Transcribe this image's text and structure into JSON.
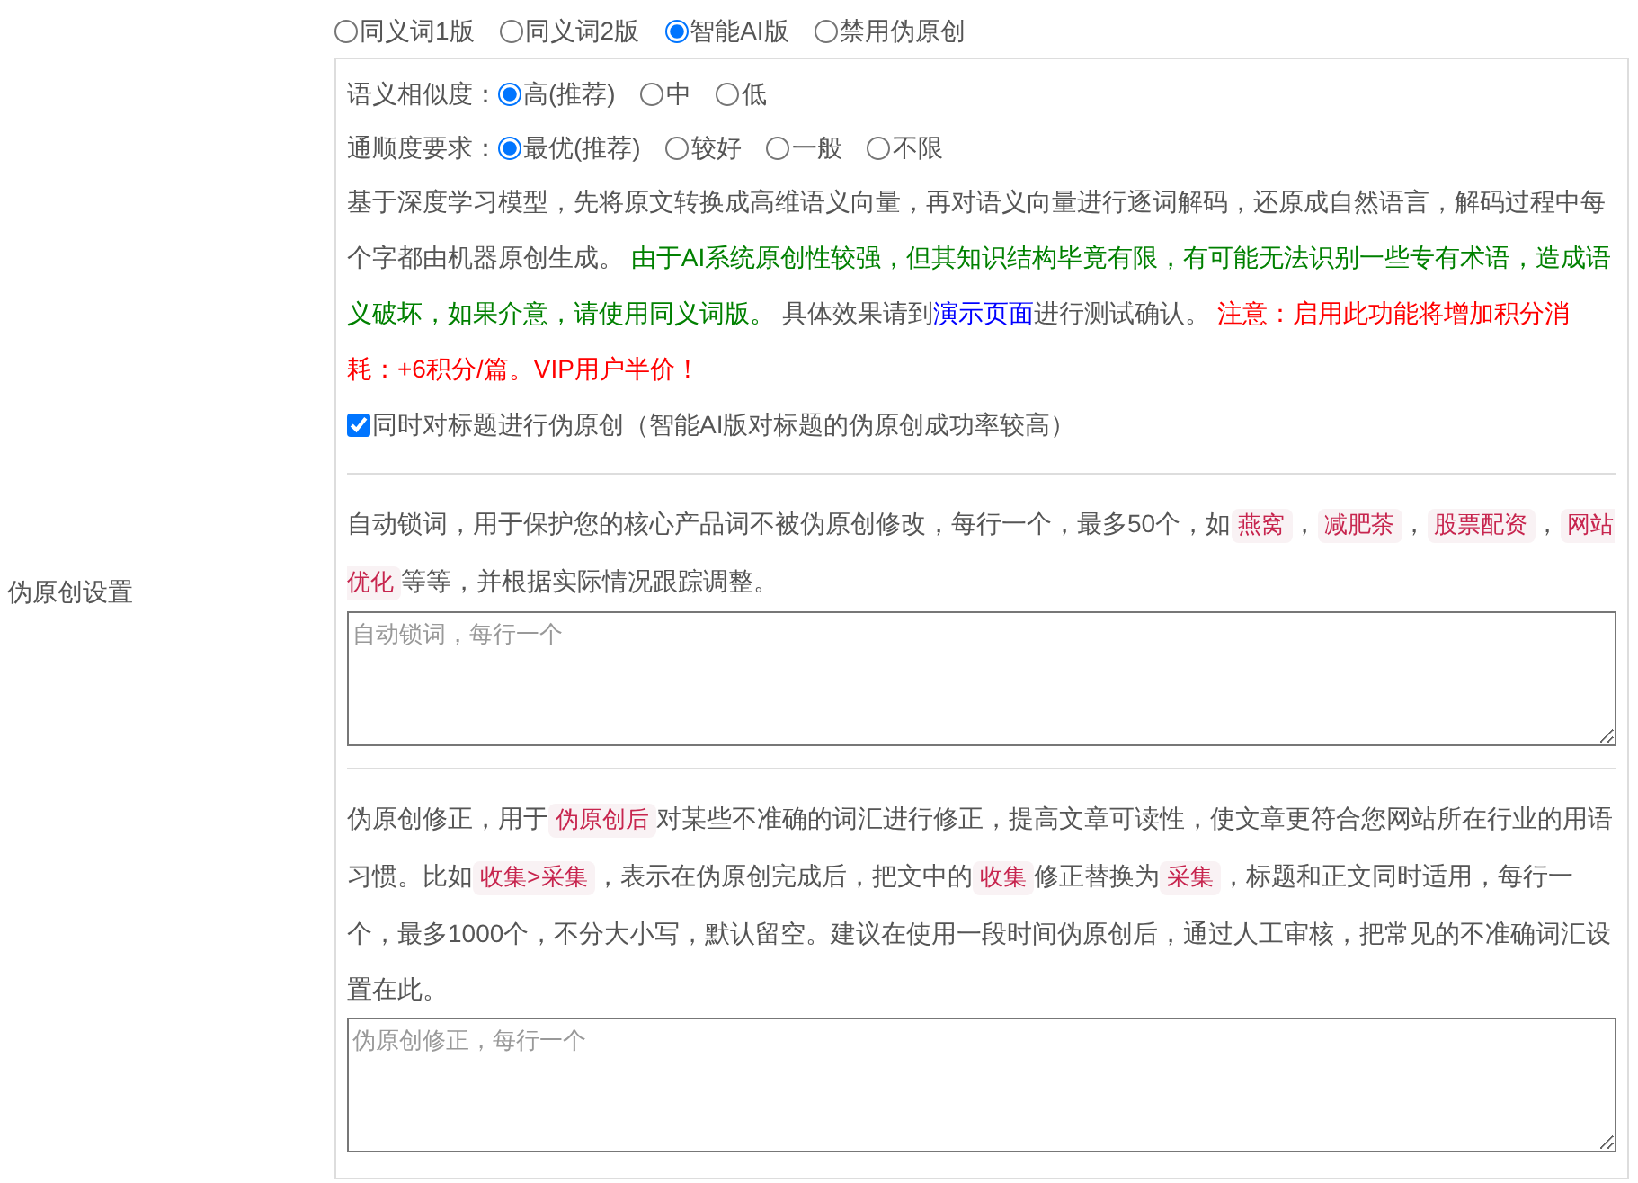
{
  "section_label": "伪原创设置",
  "mode_options": [
    {
      "label": "同义词1版",
      "selected": false
    },
    {
      "label": "同义词2版",
      "selected": false
    },
    {
      "label": "智能AI版",
      "selected": true
    },
    {
      "label": "禁用伪原创",
      "selected": false
    }
  ],
  "similarity": {
    "label": "语义相似度：",
    "options": [
      {
        "label": "高(推荐)",
        "selected": true
      },
      {
        "label": "中",
        "selected": false
      },
      {
        "label": "低",
        "selected": false
      }
    ]
  },
  "fluency": {
    "label": "通顺度要求：",
    "options": [
      {
        "label": "最优(推荐)",
        "selected": true
      },
      {
        "label": "较好",
        "selected": false
      },
      {
        "label": "一般",
        "selected": false
      },
      {
        "label": "不限",
        "selected": false
      }
    ]
  },
  "ai_description": [
    {
      "kind": "plain",
      "text": "基于深度学习模型，先将原文转换成高维语义向量，再对语义向量进行逐词解码，还原成自然语言，解码过程中每个字都由机器原创生成。 "
    },
    {
      "kind": "green",
      "text": "由于AI系统原创性较强，但其知识结构毕竟有限，有可能无法识别一些专有术语，造成语义破坏，如果介意，请使用同义词版。"
    },
    {
      "kind": "plain",
      "text": " 具体效果请到"
    },
    {
      "kind": "link",
      "text": "演示页面"
    },
    {
      "kind": "plain",
      "text": "进行测试确认。 "
    },
    {
      "kind": "red",
      "text": "注意：启用此功能将增加积分消耗：+6积分/篇。VIP用户半价！"
    }
  ],
  "title_option": {
    "label": "同时对标题进行伪原创（智能AI版对标题的伪原创成功率较高）",
    "checked": true
  },
  "lock_words": {
    "description": [
      {
        "kind": "plain",
        "text": "自动锁词，用于保护您的核心产品词不被伪原创修改，每行一个，最多50个，如"
      },
      {
        "kind": "code",
        "text": "燕窝"
      },
      {
        "kind": "plain",
        "text": "，"
      },
      {
        "kind": "code",
        "text": "减肥茶"
      },
      {
        "kind": "plain",
        "text": "，"
      },
      {
        "kind": "code",
        "text": "股票配资"
      },
      {
        "kind": "plain",
        "text": "，"
      },
      {
        "kind": "code",
        "text": "网站优化"
      },
      {
        "kind": "plain",
        "text": "等等，并根据实际情况跟踪调整。"
      }
    ],
    "placeholder": "自动锁词，每行一个"
  },
  "correction": {
    "description": [
      {
        "kind": "plain",
        "text": "伪原创修正，用于"
      },
      {
        "kind": "code",
        "text": "伪原创后"
      },
      {
        "kind": "plain",
        "text": "对某些不准确的词汇进行修正，提高文章可读性，使文章更符合您网站所在行业的用语习惯。比如"
      },
      {
        "kind": "code",
        "text": "收集>采集"
      },
      {
        "kind": "plain",
        "text": "，表示在伪原创完成后，把文中的"
      },
      {
        "kind": "code",
        "text": "收集"
      },
      {
        "kind": "plain",
        "text": "修正替换为"
      },
      {
        "kind": "code",
        "text": "采集"
      },
      {
        "kind": "plain",
        "text": "，标题和正文同时适用，每行一个，最多1000个，不分大小写，默认留空。建议在使用一段时间伪原创后，通过人工审核，把常见的不准确词汇设置在此。"
      }
    ],
    "placeholder": "伪原创修正，每行一个"
  }
}
